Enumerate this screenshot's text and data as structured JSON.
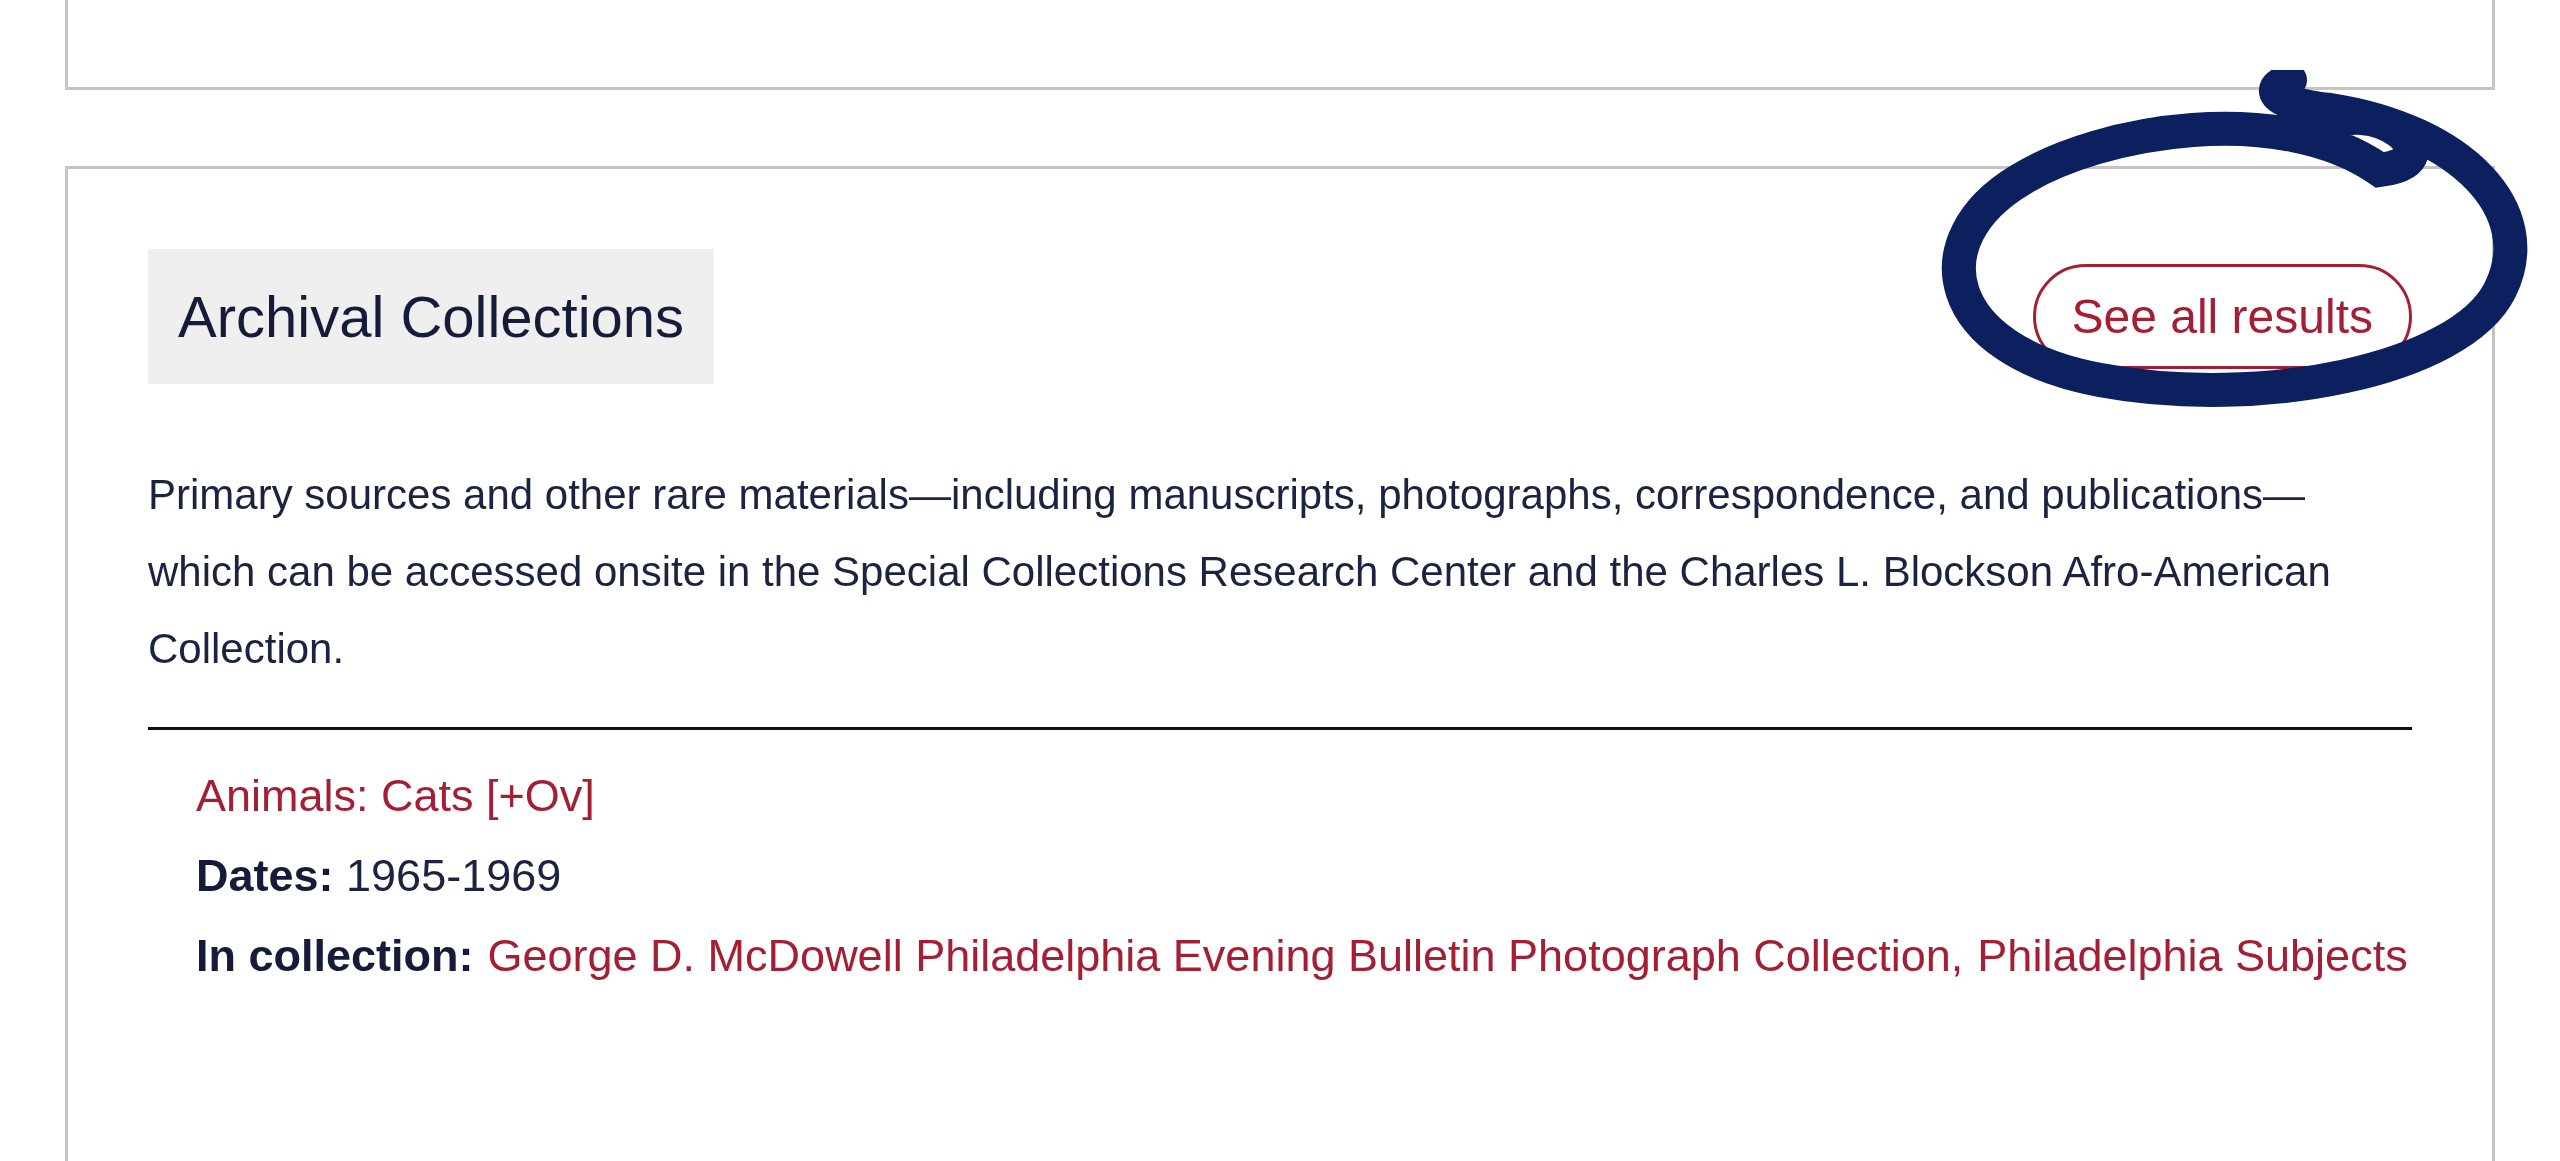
{
  "section": {
    "title": "Archival Collections",
    "see_all_button": "See all results",
    "description": "Primary sources and other rare materials—including manuscripts, photographs, correspondence, and publications—which can be accessed onsite in the Special Collections Research Center and the Charles L. Blockson Afro-American Collection.",
    "results": [
      {
        "title": "Animals: Cats [+Ov]",
        "dates_label": "Dates:",
        "dates": "1965-1969",
        "collection_label": "In collection:",
        "collections": [
          "George D. McDowell Philadelphia Evening Bulletin Photograph Collection,",
          "Philadelphia Subjects"
        ]
      }
    ]
  }
}
